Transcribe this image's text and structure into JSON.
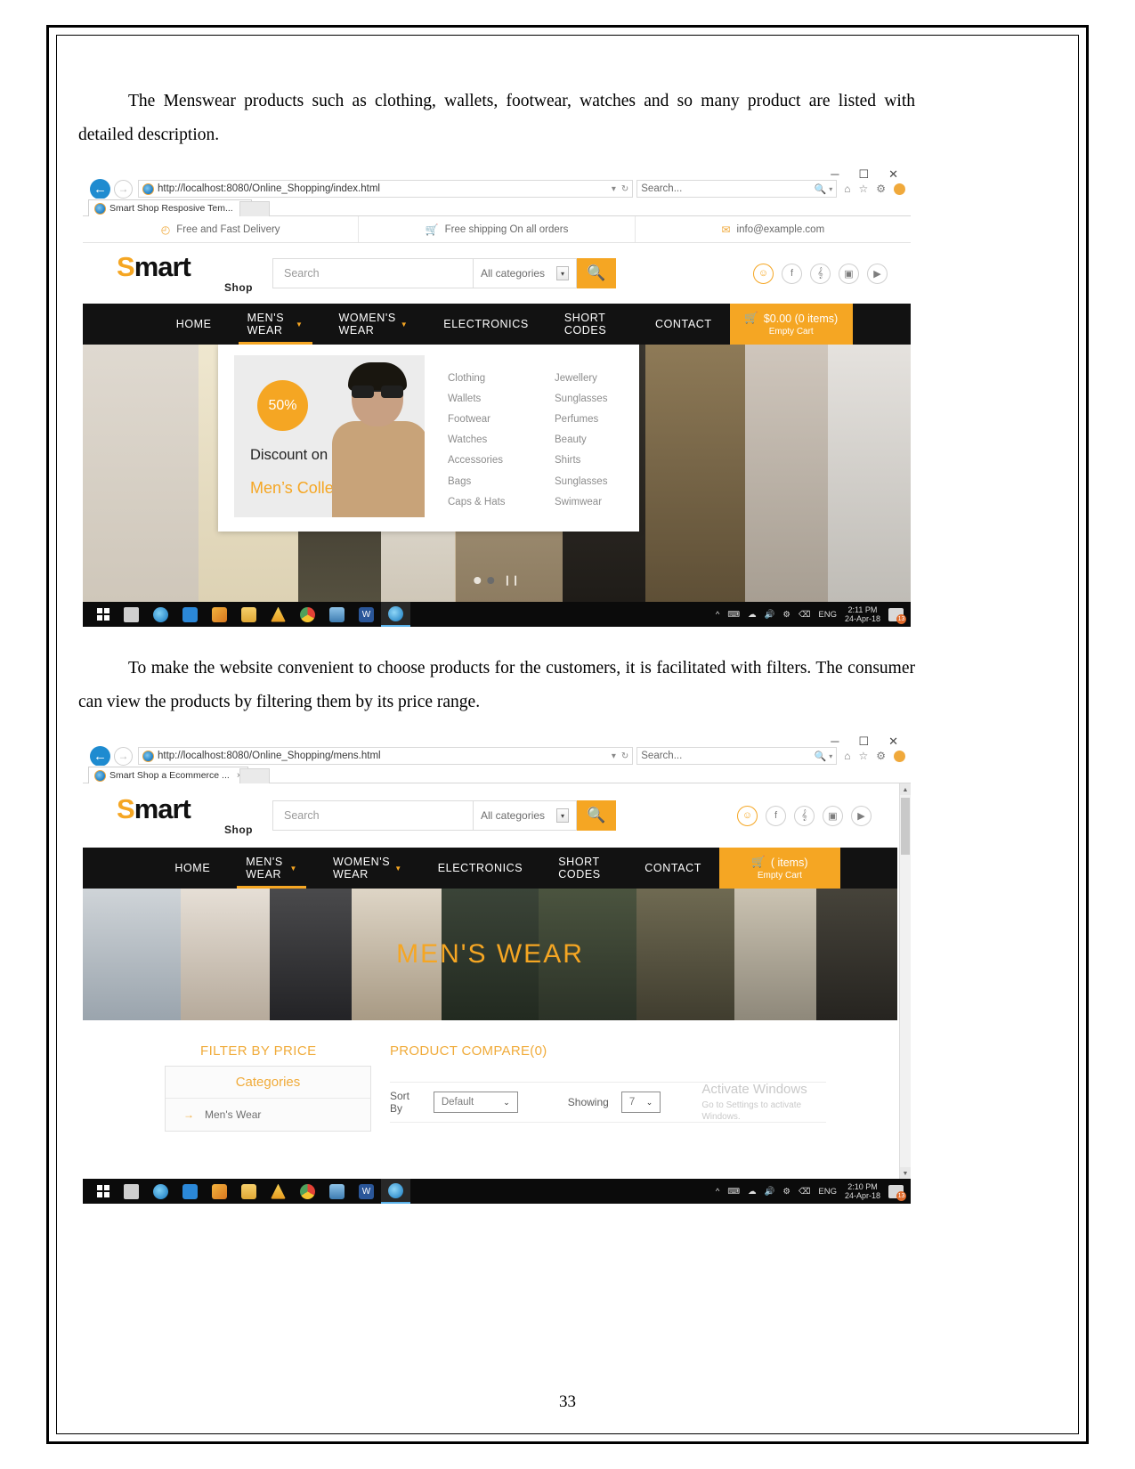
{
  "document": {
    "paragraph1": "The Menswear products such as clothing, wallets, footwear, watches and so many product are listed with detailed description.",
    "paragraph2": "To make the website convenient to choose products for the customers, it is facilitated with filters. The consumer can view the products by filtering them by its price range.",
    "page_number": "33"
  },
  "screenshot1": {
    "browser": {
      "url": "http://localhost:8080/Online_Shopping/index.html",
      "url_prefix": "http://",
      "url_host": "localhost",
      "url_rest": ":8080/Online_Shopping/index.html",
      "search_placeholder": "Search...",
      "tab_title": "Smart Shop Resposive Tem...",
      "tab_close": "×",
      "minimize": "─",
      "maximize": "☐",
      "close": "✕",
      "back_icon": "←",
      "forward_icon": "→",
      "refresh_icon": "↻",
      "dropdown_icon": "▾",
      "home_icon": "⌂",
      "star_icon": "☆",
      "gear_icon": "⚙"
    },
    "infobar": [
      {
        "icon": "clock-icon",
        "glyph": "◴",
        "label": "Free and Fast Delivery"
      },
      {
        "icon": "cart-icon",
        "glyph": "🛒",
        "label": "Free shipping On all orders"
      },
      {
        "icon": "mail-icon",
        "glyph": "✉",
        "label": "info@example.com"
      }
    ],
    "header": {
      "logo_s": "S",
      "logo_rest": "mart",
      "logo_sub": "Shop",
      "search_placeholder": "Search",
      "category_selected": "All categories",
      "search_button_icon": "🔍",
      "socials": [
        {
          "name": "user",
          "glyph": "☺"
        },
        {
          "name": "facebook",
          "glyph": "f"
        },
        {
          "name": "twitter",
          "glyph": "ᵗ"
        },
        {
          "name": "instagram",
          "glyph": "▣"
        },
        {
          "name": "youtube",
          "glyph": "▶"
        }
      ]
    },
    "nav": {
      "items": [
        {
          "label": "HOME",
          "caret": false,
          "active": false
        },
        {
          "label": "MEN'S WEAR",
          "caret": true,
          "active": true
        },
        {
          "label": "WOMEN'S WEAR",
          "caret": true,
          "active": false
        },
        {
          "label": "ELECTRONICS",
          "caret": false,
          "active": false
        },
        {
          "label": "SHORT CODES",
          "caret": false,
          "active": false
        },
        {
          "label": "CONTACT",
          "caret": false,
          "active": false
        }
      ],
      "cart_total": "$0.00 (0 items)",
      "cart_sub": "Empty Cart",
      "cart_icon": "🛒"
    },
    "megamenu": {
      "promo_badge": "50%",
      "promo_line1": "Discount on",
      "promo_line2": "Men’s Collections",
      "col1": [
        "Clothing",
        "Wallets",
        "Footwear",
        "Watches",
        "Accessories",
        "Bags",
        "Caps & Hats"
      ],
      "col2": [
        "Jewellery",
        "Sunglasses",
        "Perfumes",
        "Beauty",
        "Shirts",
        "Sunglasses",
        "Swimwear"
      ]
    },
    "taskbar": {
      "language": "ENG",
      "time": "2:11 PM",
      "date": "24-Apr-18",
      "notif_count": "13",
      "tray_glyphs": [
        "∧",
        "⌨",
        "◧",
        "🔊",
        "⚖",
        "⌨"
      ]
    }
  },
  "screenshot2": {
    "browser": {
      "url": "http://localhost:8080/Online_Shopping/mens.html",
      "url_prefix": "http://",
      "url_host": "localhost",
      "url_rest": ":8080/Online_Shopping/mens.html",
      "search_placeholder": "Search...",
      "tab_title": "Smart Shop a Ecommerce ...",
      "tab_close": "×"
    },
    "header": {
      "logo_s": "S",
      "logo_rest": "mart",
      "logo_sub": "Shop",
      "search_placeholder": "Search",
      "category_selected": "All categories",
      "search_button_icon": "🔍"
    },
    "nav": {
      "items": [
        {
          "label": "HOME",
          "caret": false,
          "active": false
        },
        {
          "label": "MEN'S WEAR",
          "caret": true,
          "active": true
        },
        {
          "label": "WOMEN'S WEAR",
          "caret": true,
          "active": false
        },
        {
          "label": "ELECTRONICS",
          "caret": false,
          "active": false
        },
        {
          "label": "SHORT CODES",
          "caret": false,
          "active": false
        },
        {
          "label": "CONTACT",
          "caret": false,
          "active": false
        }
      ],
      "cart_total": "( items)",
      "cart_sub": "Empty Cart",
      "cart_icon": "🛒"
    },
    "hero_title": "MEN'S WEAR",
    "filter": {
      "title": "FILTER BY PRICE",
      "categories_title": "Categories",
      "category_items": [
        {
          "arrow": "→",
          "label": "Men's Wear"
        }
      ]
    },
    "compare": {
      "title": "PRODUCT COMPARE(0)",
      "sort_label": "Sort By",
      "sort_value": "Default",
      "showing_label": "Showing",
      "showing_value": "7",
      "caret": "⌄"
    },
    "watermark": {
      "line1": "Activate Windows",
      "line2": "Go to Settings to activate Windows."
    },
    "taskbar": {
      "language": "ENG",
      "time": "2:10 PM",
      "date": "24-Apr-18",
      "notif_count": "13"
    }
  }
}
